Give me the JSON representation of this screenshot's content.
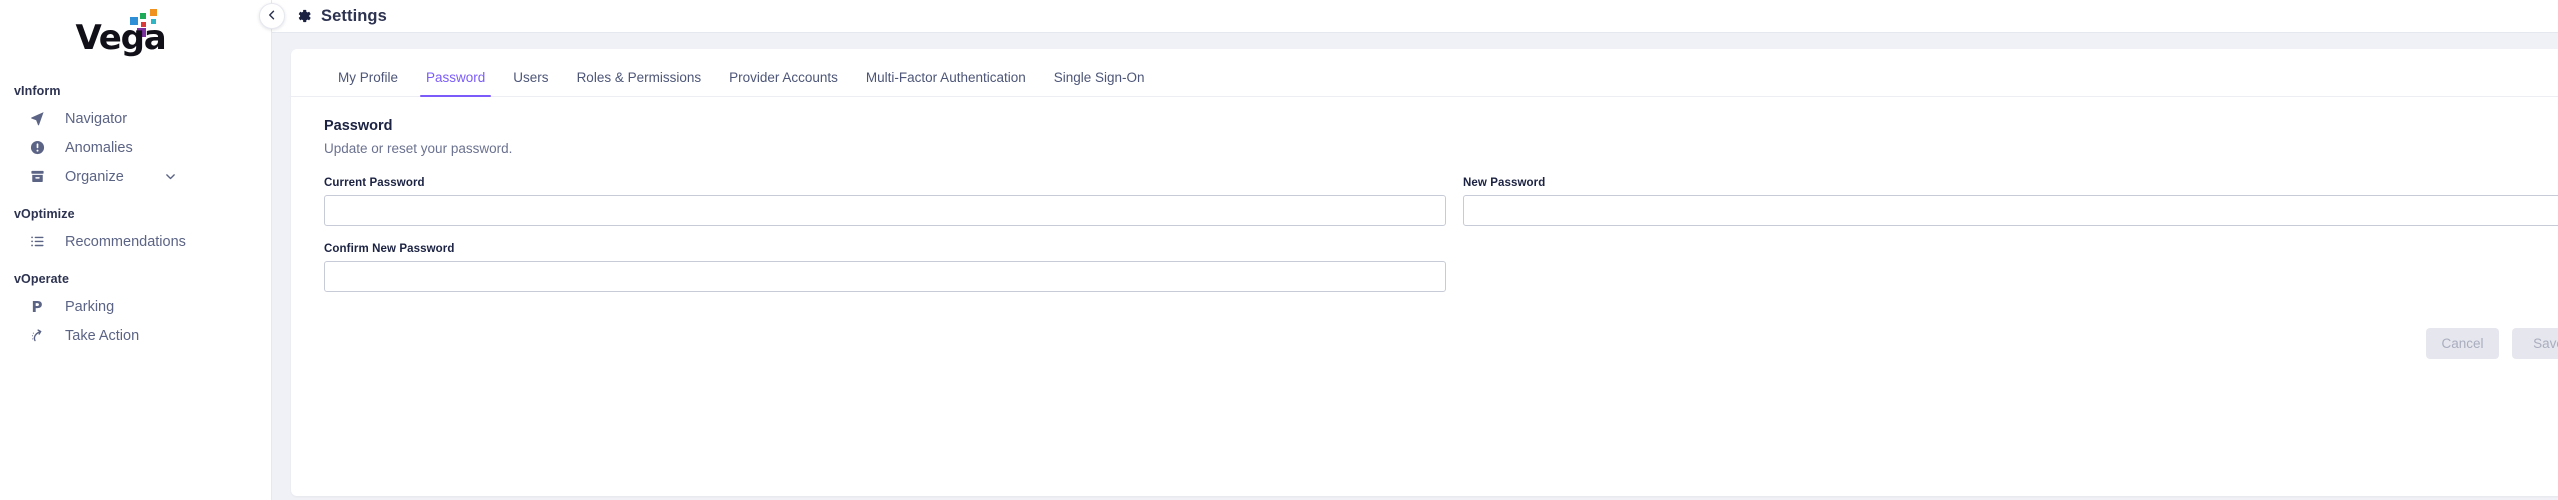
{
  "brand": {
    "name": "Vega",
    "logo_dot_colors": [
      "#2e8ed6",
      "#f0921f",
      "#1faa5a",
      "#d93a3a",
      "#7a2f9e",
      "#2fb5c4"
    ]
  },
  "sidebar": {
    "sections": [
      {
        "label": "vInform",
        "items": [
          {
            "label": "Navigator",
            "icon": "navigator-icon",
            "chevron": false
          },
          {
            "label": "Anomalies",
            "icon": "anomalies-icon",
            "chevron": false
          },
          {
            "label": "Organize",
            "icon": "organize-icon",
            "chevron": true
          }
        ]
      },
      {
        "label": "vOptimize",
        "items": [
          {
            "label": "Recommendations",
            "icon": "recommendations-icon",
            "chevron": false
          }
        ]
      },
      {
        "label": "vOperate",
        "items": [
          {
            "label": "Parking",
            "icon": "parking-icon",
            "chevron": false
          },
          {
            "label": "Take Action",
            "icon": "take-action-icon",
            "chevron": false
          }
        ]
      }
    ]
  },
  "header": {
    "title": "Settings",
    "back_icon": "chevron-left-icon",
    "gear_icon": "gear-icon",
    "bell_icon": "bell-icon"
  },
  "tabs": [
    {
      "label": "My Profile",
      "active": false
    },
    {
      "label": "Password",
      "active": true
    },
    {
      "label": "Users",
      "active": false
    },
    {
      "label": "Roles & Permissions",
      "active": false
    },
    {
      "label": "Provider Accounts",
      "active": false
    },
    {
      "label": "Multi-Factor Authentication",
      "active": false
    },
    {
      "label": "Single Sign-On",
      "active": false
    }
  ],
  "section": {
    "title": "Password",
    "subtitle": "Update or reset your password."
  },
  "form": {
    "current_password": {
      "label": "Current Password",
      "value": "",
      "placeholder": ""
    },
    "new_password": {
      "label": "New Password",
      "value": "",
      "placeholder": ""
    },
    "confirm_new_password": {
      "label": "Confirm New Password",
      "value": "",
      "placeholder": ""
    }
  },
  "actions": {
    "cancel_label": "Cancel",
    "save_label": "Save",
    "disabled": true
  },
  "colors": {
    "accent": "#7b5cfa",
    "page_background": "#f0f1f6",
    "text_primary": "#1b2242",
    "text_muted": "#6b7290"
  }
}
